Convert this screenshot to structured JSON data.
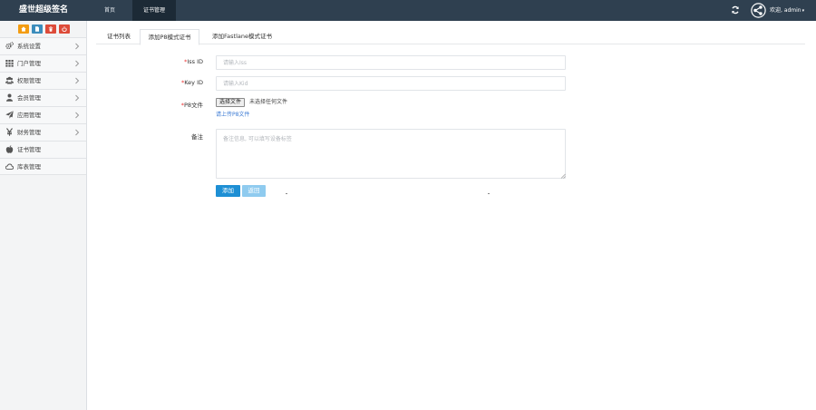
{
  "header": {
    "brand": "盛世超级签名",
    "nav": [
      {
        "label": "首页",
        "active": false
      },
      {
        "label": "证书管理",
        "active": true
      }
    ],
    "welcome": "欢迎, admin",
    "caret": "▾",
    "refresh_icon": "refresh-icon",
    "avatar_icon": "share-circle-icon"
  },
  "sidebar": {
    "shortcut_colors": [
      "#f39c12",
      "#3c8dbc",
      "#dd4b39",
      "#dd4b39"
    ],
    "items": [
      {
        "label": "系统设置",
        "icon": "gears-icon",
        "has_children": true
      },
      {
        "label": "门户管理",
        "icon": "grid-icon",
        "has_children": true
      },
      {
        "label": "权限管理",
        "icon": "users-icon",
        "has_children": true
      },
      {
        "label": "会员管理",
        "icon": "user-icon",
        "has_children": true
      },
      {
        "label": "应用管理",
        "icon": "send-icon",
        "has_children": true
      },
      {
        "label": "财务管理",
        "icon": "yen-icon",
        "has_children": true
      },
      {
        "label": "证书管理",
        "icon": "apple-icon",
        "has_children": false
      },
      {
        "label": "库表管理",
        "icon": "cloud-icon",
        "has_children": false
      }
    ]
  },
  "tabs": [
    {
      "label": "证书列表",
      "active": false
    },
    {
      "label": "添加P8模式证书",
      "active": true
    },
    {
      "label": "添加Fastlane模式证书",
      "active": false
    }
  ],
  "form": {
    "iss_label": "Iss ID",
    "iss_placeholder": "请输入Iss",
    "key_label": "Key ID",
    "key_placeholder": "请输入Kid",
    "p8_label": "P8文件",
    "file_button": "选择文件",
    "file_status": "未选择任何文件",
    "file_hint": "请上传P8文件",
    "remark_label": "备注",
    "remark_placeholder": "备注信息, 可以填写设备标签",
    "required_mark": "*"
  },
  "actions": {
    "add": "添加",
    "back": "返回"
  }
}
